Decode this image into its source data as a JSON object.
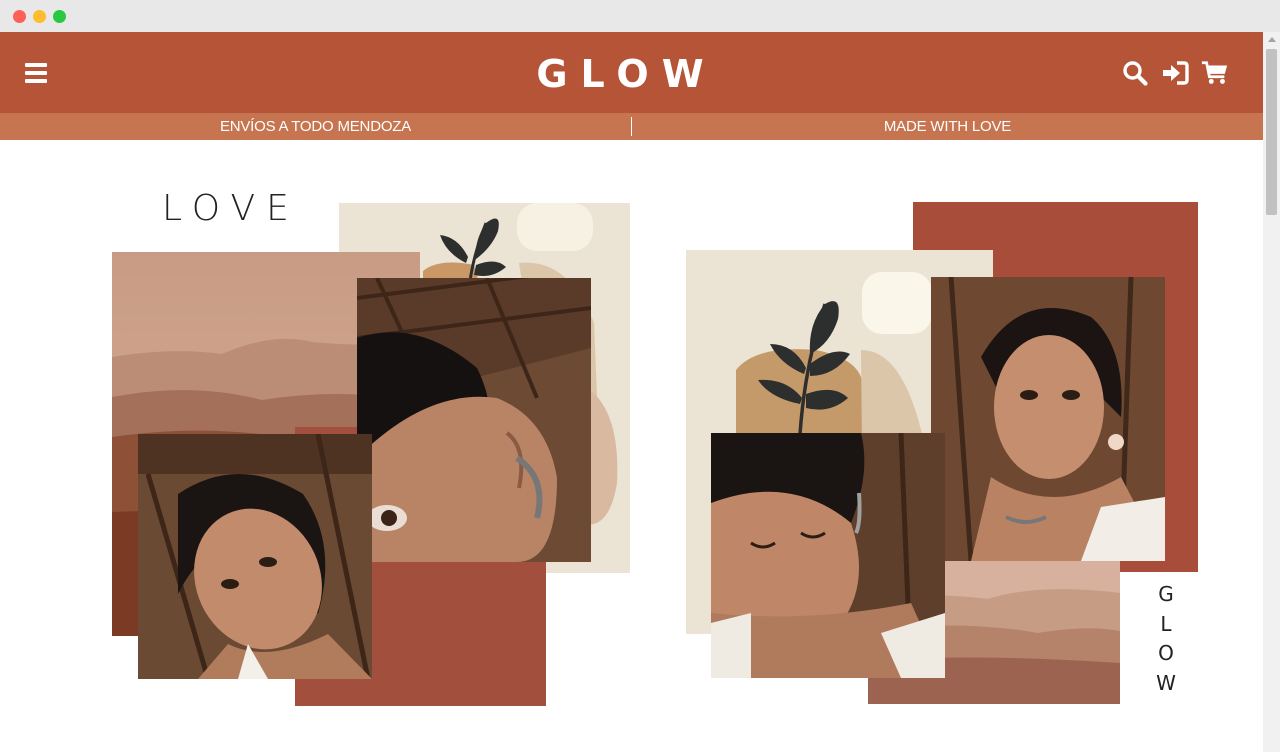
{
  "header": {
    "logo": "GLOW",
    "menu_icon": "hamburger-menu-icon",
    "icons": [
      "search-icon",
      "sign-in-icon",
      "cart-icon"
    ],
    "brand_color": "#b55436",
    "promo_color": "#c77550"
  },
  "promo_bar": {
    "left": "ENVÍOS A TODO MENDOZA",
    "right": "MADE WITH LOVE"
  },
  "collage": {
    "love_text": "LOVE",
    "glow_letters": [
      "G",
      "L",
      "O",
      "W"
    ]
  }
}
